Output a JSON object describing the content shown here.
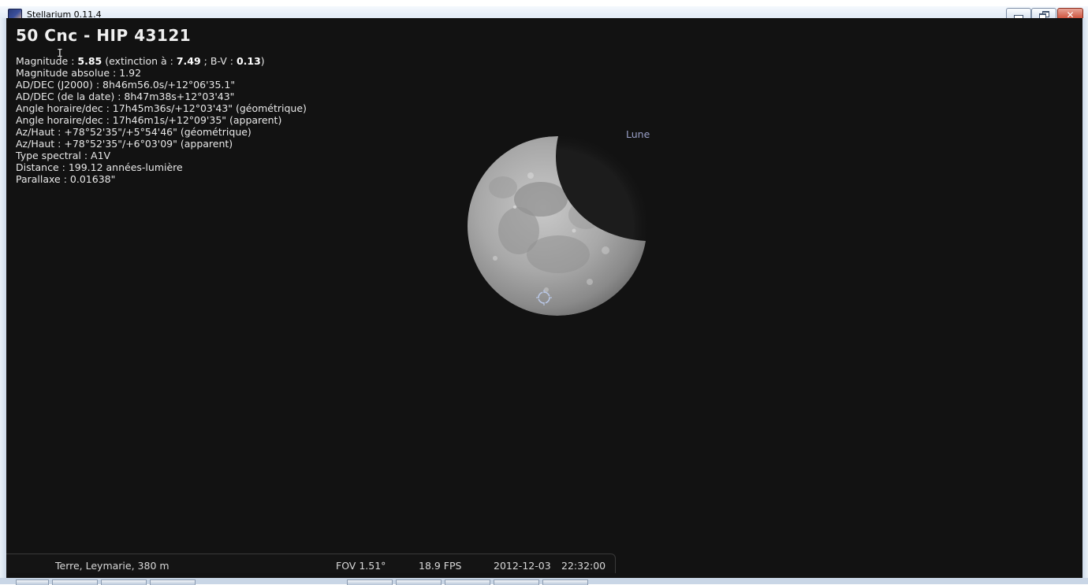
{
  "window": {
    "title": "Stellarium 0.11.4"
  },
  "object": {
    "title": "50 Cnc - HIP 43121",
    "info": [
      {
        "pre": "Magnitude : ",
        "b1": "5.85",
        "mid": " (extinction à  : ",
        "b2": "7.49",
        "mid2": " ; B-V : ",
        "b3": "0.13",
        "post": ")"
      },
      {
        "pre": "Magnitude absolue : 1.92"
      },
      {
        "pre": "AD/DEC (J2000) : 8h46m56.0s/+12°06'35.1\""
      },
      {
        "pre": "AD/DEC (de la date) : 8h47m38s+12°03'43\""
      },
      {
        "pre": "Angle horaire/dec : 17h45m36s/+12°03'43\" (géométrique)"
      },
      {
        "pre": "Angle horaire/dec : 17h46m1s/+12°09'35\" (apparent)"
      },
      {
        "pre": "Az/Haut : +78°52'35\"/+5°54'46\" (géométrique)"
      },
      {
        "pre": "Az/Haut : +78°52'35\"/+6°03'09\" (apparent)"
      },
      {
        "pre": "Type spectral : A1V"
      },
      {
        "pre": "Distance : 199.12 années-lumière"
      },
      {
        "pre": "Parallaxe : 0.01638\""
      }
    ]
  },
  "sky": {
    "moon_label": "Lune",
    "background_color": "#121212"
  },
  "status": {
    "location": "Terre, Leymarie, 380 m",
    "fov": "FOV 1.51°",
    "fps": "18.9 FPS",
    "date": "2012-12-03",
    "time": "22:32:00"
  },
  "icons": {
    "app": "stellarium-app-icon",
    "minimize": "minimize-icon",
    "maximize": "restore-icon",
    "close": "close-icon",
    "target": "target-crosshair-icon"
  }
}
